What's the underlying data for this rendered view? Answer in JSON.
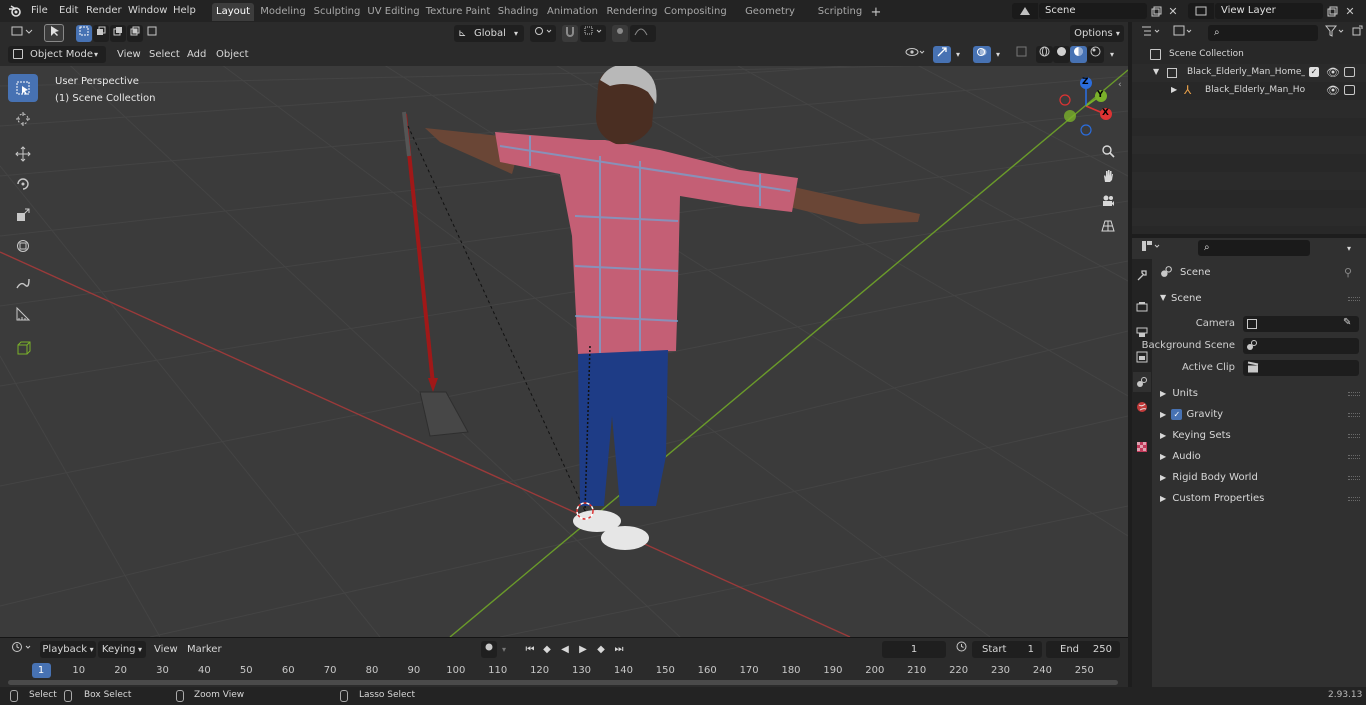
{
  "menu": [
    "File",
    "Edit",
    "Render",
    "Window",
    "Help"
  ],
  "workspaces": [
    "Layout",
    "Modeling",
    "Sculpting",
    "UV Editing",
    "Texture Paint",
    "Shading",
    "Animation",
    "Rendering",
    "Compositing",
    "Geometry Nodes",
    "Scripting"
  ],
  "active_workspace": "Layout",
  "scene_name": "Scene",
  "view_layer": "View Layer",
  "viewport": {
    "mode": "Object Mode",
    "header_menus": [
      "View",
      "Select",
      "Add",
      "Object"
    ],
    "transform_orientation": "Global",
    "options_label": "Options",
    "overlay_line1": "User Perspective",
    "overlay_line2": "(1) Scene Collection",
    "gizmo_axes": {
      "x": "X",
      "y": "Y",
      "z": "Z"
    }
  },
  "outliner": {
    "root": "Scene Collection",
    "items": [
      {
        "label": "Black_Elderly_Man_Home_Sty"
      },
      {
        "label": "Black_Elderly_Man_Home"
      }
    ]
  },
  "properties": {
    "context_title": "Scene",
    "section": "Scene",
    "fields": [
      {
        "label": "Camera"
      },
      {
        "label": "Background Scene"
      },
      {
        "label": "Active Clip"
      }
    ],
    "subpanels": [
      "Units",
      "Gravity",
      "Keying Sets",
      "Audio",
      "Rigid Body World",
      "Custom Properties"
    ],
    "gravity_checked": true
  },
  "timeline": {
    "menus": [
      "Playback",
      "Keying",
      "View",
      "Marker"
    ],
    "current_frame": "1",
    "start_label": "Start",
    "start_value": "1",
    "end_label": "End",
    "end_value": "250",
    "ruler": [
      "1",
      "10",
      "20",
      "30",
      "40",
      "50",
      "60",
      "70",
      "80",
      "90",
      "100",
      "110",
      "120",
      "130",
      "140",
      "150",
      "160",
      "170",
      "180",
      "190",
      "200",
      "210",
      "220",
      "230",
      "240",
      "250"
    ]
  },
  "status": {
    "select": "Select",
    "box_select": "Box Select",
    "zoom_view": "Zoom View",
    "lasso_select": "Lasso Select",
    "version": "2.93.13"
  },
  "colors": {
    "accent": "#4772b3",
    "x_axis": "#9a3a3a",
    "y_axis": "#6a9a2a"
  }
}
